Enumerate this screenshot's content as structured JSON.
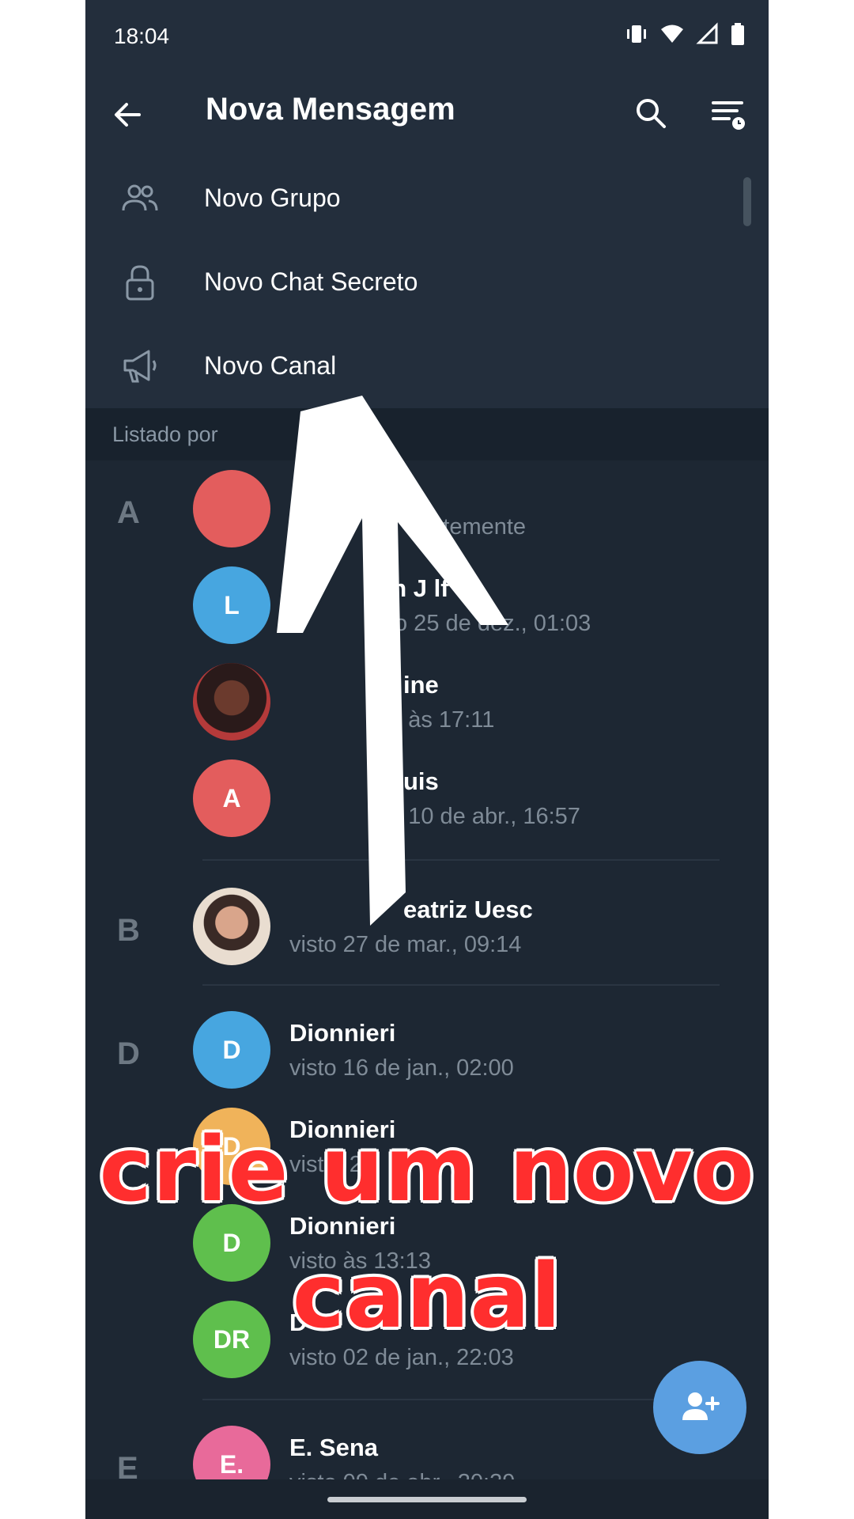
{
  "status_bar": {
    "time": "18:04"
  },
  "header": {
    "title": "Nova Mensagem"
  },
  "menu": [
    {
      "label": "Novo Grupo",
      "icon": "group-icon"
    },
    {
      "label": "Novo Chat Secreto",
      "icon": "lock-icon"
    },
    {
      "label": "Novo Canal",
      "icon": "megaphone-icon"
    }
  ],
  "section_header": "Listado por",
  "contacts": [
    {
      "letter": "A",
      "name": "le",
      "status": "entemente",
      "avatar_text": "",
      "avatar_color": "#e35d5d"
    },
    {
      "letter": "",
      "name": "an J      lf",
      "status": "isto 25 de dez., 01:03",
      "avatar_text": "L",
      "avatar_color": "#47a6e0"
    },
    {
      "letter": "",
      "name": "ine",
      "status": "to às 17:11",
      "avatar_text": "",
      "avatar_color": "photo"
    },
    {
      "letter": "",
      "name": "uis",
      "status": "to 10 de abr., 16:57",
      "avatar_text": "A",
      "avatar_color": "#e35d5d"
    },
    {
      "letter": "B",
      "name": "eatriz Uesc",
      "status": "visto 27 de mar., 09:14",
      "avatar_text": "",
      "avatar_color": "photo"
    },
    {
      "letter": "D",
      "name": "Dionnieri",
      "status": "visto 16 de jan., 02:00",
      "avatar_text": "D",
      "avatar_color": "#47a6e0"
    },
    {
      "letter": "",
      "name": "Dionnieri",
      "status": "vist   1     2",
      "avatar_text": "D",
      "avatar_color": "#f0b35a"
    },
    {
      "letter": "",
      "name": "Dionnieri",
      "status": "visto às 13:13",
      "avatar_text": "D",
      "avatar_color": "#5fbf4d"
    },
    {
      "letter": "",
      "name": "D",
      "status": "visto 02 de jan., 22:03",
      "avatar_text": "DR",
      "avatar_color": "#5fbf4d"
    },
    {
      "letter": "E",
      "name": "E. Sena",
      "status": "visto 09 de abr., 20:39",
      "avatar_text": "E.",
      "avatar_color": "#e86a9a"
    }
  ],
  "overlay": {
    "caption_line1": "crie um novo",
    "caption_line2": "canal"
  },
  "colors": {
    "bg": "#1d2733",
    "header": "#232e3c",
    "accent": "#5b9fe1",
    "caption": "#ff2e2e"
  }
}
